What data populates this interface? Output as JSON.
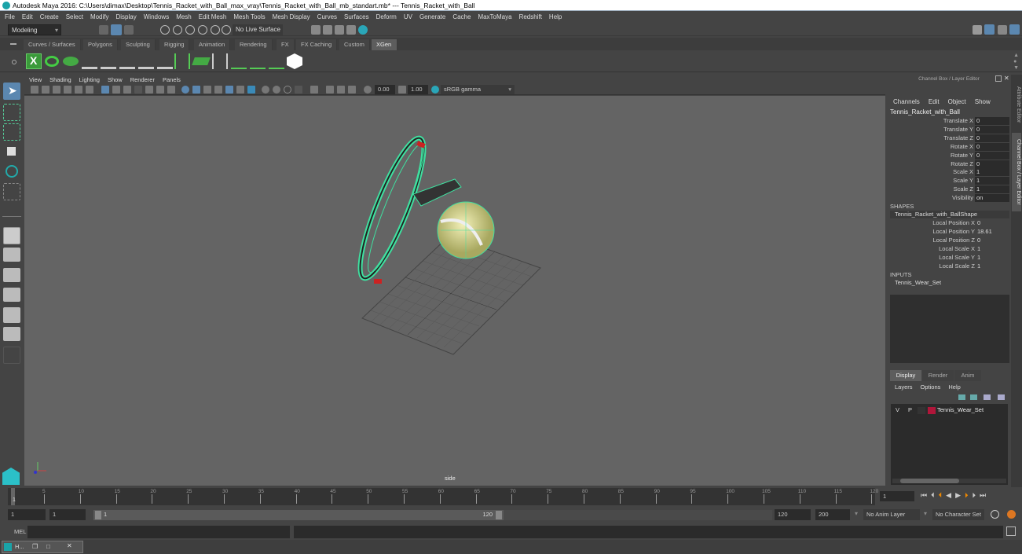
{
  "window": {
    "title": "Autodesk Maya 2016: C:\\Users\\dimax\\Desktop\\Tennis_Racket_with_Ball_max_vray\\Tennis_Racket_with_Ball_mb_standart.mb*   ---   Tennis_Racket_with_Ball"
  },
  "menubar": [
    "File",
    "Edit",
    "Create",
    "Select",
    "Modify",
    "Display",
    "Windows",
    "Mesh",
    "Edit Mesh",
    "Mesh Tools",
    "Mesh Display",
    "Curves",
    "Surfaces",
    "Deform",
    "UV",
    "Generate",
    "Cache",
    "MaxToMaya",
    "Redshift",
    "Help"
  ],
  "statusline": {
    "mode": "Modeling",
    "live_surface": "No Live Surface"
  },
  "shelf": {
    "tabs": [
      "Curves / Surfaces",
      "Polygons",
      "Sculpting",
      "Rigging",
      "Animation",
      "Rendering",
      "FX",
      "FX Caching",
      "Custom",
      "XGen"
    ],
    "active_tab": "XGen",
    "icons": [
      "xgen-editor-icon",
      "xgen-preview-icon",
      "xgen-clear-preview-icon",
      "xgen-add-guides-icon",
      "xgen-sculpt-guides-icon",
      "xgen-add-guide-icon",
      "xgen-show-guides-icon",
      "xgen-lock-guides-icon",
      "xgen-guides-icon",
      "xgen-density-icon",
      "xgen-bend-icon",
      "xgen-select-icon",
      "xgen-groom-icon",
      "xgen-delete-icon",
      "xgen-p-icon"
    ]
  },
  "viewport": {
    "menu": [
      "View",
      "Shading",
      "Lighting",
      "Show",
      "Renderer",
      "Panels"
    ],
    "exposure": "0.00",
    "gamma": "1.00",
    "color_space": "sRGB gamma",
    "camera_label": "side"
  },
  "channel_box": {
    "header": "Channel Box / Layer Editor",
    "menu": [
      "Channels",
      "Edit",
      "Object",
      "Show"
    ],
    "object_name": "Tennis_Racket_with_Ball",
    "channels": [
      {
        "label": "Translate X",
        "value": "0"
      },
      {
        "label": "Translate Y",
        "value": "0"
      },
      {
        "label": "Translate Z",
        "value": "0"
      },
      {
        "label": "Rotate X",
        "value": "0"
      },
      {
        "label": "Rotate Y",
        "value": "0"
      },
      {
        "label": "Rotate Z",
        "value": "0"
      },
      {
        "label": "Scale X",
        "value": "1"
      },
      {
        "label": "Scale Y",
        "value": "1"
      },
      {
        "label": "Scale Z",
        "value": "1"
      },
      {
        "label": "Visibility",
        "value": "on"
      }
    ],
    "shapes_header": "SHAPES",
    "shape_name": "Tennis_Racket_with_BallShape",
    "shape_channels": [
      {
        "label": "Local Position X",
        "value": "0"
      },
      {
        "label": "Local Position Y",
        "value": "18.61"
      },
      {
        "label": "Local Position Z",
        "value": "0"
      },
      {
        "label": "Local Scale X",
        "value": "1"
      },
      {
        "label": "Local Scale Y",
        "value": "1"
      },
      {
        "label": "Local Scale Z",
        "value": "1"
      }
    ],
    "inputs_header": "INPUTS",
    "input_name": "Tennis_Wear_Set"
  },
  "layer_editor": {
    "tabs": [
      "Display",
      "Render",
      "Anim"
    ],
    "active_tab": "Display",
    "menu": [
      "Layers",
      "Options",
      "Help"
    ],
    "layers": [
      {
        "v": "V",
        "p": "P",
        "color": "#b0163a",
        "name": "Tennis_Wear_Set"
      }
    ]
  },
  "side_tabs": [
    "Attribute Editor",
    "Channel Box / Layer Editor"
  ],
  "timeline": {
    "ticks": [
      "5",
      "10",
      "15",
      "20",
      "25",
      "30",
      "35",
      "40",
      "45",
      "50",
      "55",
      "60",
      "65",
      "70",
      "75",
      "80",
      "85",
      "90",
      "95",
      "100",
      "105",
      "110",
      "115",
      "120"
    ],
    "current_frame_marker": "1",
    "current_frame": "1"
  },
  "range": {
    "start": "1",
    "playback_start": "1",
    "slider_start": "1",
    "slider_end": "120",
    "playback_end": "120",
    "end": "200",
    "anim_layer": "No Anim Layer",
    "character_set": "No Character Set"
  },
  "cmdline": {
    "label": "MEL"
  },
  "taskbar": {
    "item": "H..."
  }
}
